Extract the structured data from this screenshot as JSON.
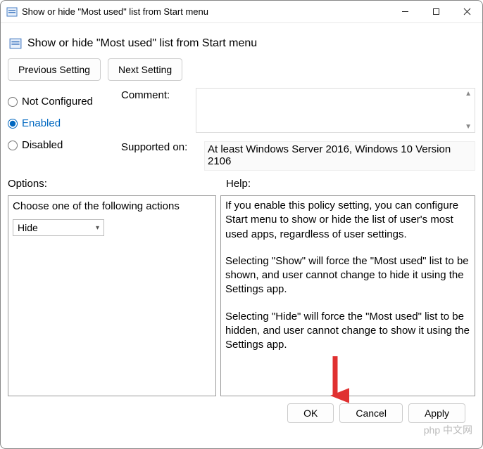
{
  "titlebar": {
    "title": "Show or hide \"Most used\" list from Start menu"
  },
  "header": {
    "title": "Show or hide \"Most used\" list from Start menu"
  },
  "nav": {
    "previous": "Previous Setting",
    "next": "Next Setting"
  },
  "radios": {
    "not_configured": "Not Configured",
    "enabled": "Enabled",
    "disabled": "Disabled",
    "selected": "enabled"
  },
  "comment": {
    "label": "Comment:",
    "value": ""
  },
  "supported": {
    "label": "Supported on:",
    "value": "At least Windows Server 2016, Windows 10 Version 2106"
  },
  "panels": {
    "options_label": "Options:",
    "help_label": "Help:"
  },
  "options": {
    "prompt": "Choose one of the following actions",
    "selected": "Hide"
  },
  "help": {
    "p1": "If you enable this policy setting, you can configure Start menu to show or hide the list of user's most used apps, regardless of user settings.",
    "p2": "Selecting \"Show\" will force the \"Most used\" list to be shown, and user cannot change to hide it using the Settings app.",
    "p3": "Selecting \"Hide\" will force the \"Most used\" list to be hidden, and user cannot change to show it using the Settings app."
  },
  "footer": {
    "ok": "OK",
    "cancel": "Cancel",
    "apply": "Apply"
  },
  "watermark": "php 中文网"
}
